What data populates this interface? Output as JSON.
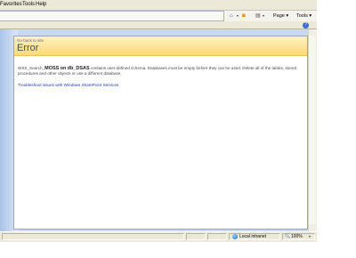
{
  "menubar": {
    "items": [
      "Favorites",
      "Tools",
      "Help"
    ]
  },
  "command_bar": {
    "home_icon": "home-icon",
    "feeds_icon": "feeds-icon",
    "print_icon": "print-icon",
    "page_label": "Page",
    "tools_label": "Tools",
    "dropdown_glyph": "▾"
  },
  "error_page": {
    "back_link": "Go back to site",
    "title": "Error",
    "message_prefix": "WSS_Search_",
    "message_server": "MOSS",
    "message_on": "on",
    "message_db": "db_DSAS",
    "message_rest": "contains user-defined schema.  Databases must be empty before they can be used.  Delete all of the tables, stored procedures and other objects or use a different database.",
    "troubleshoot_link": "Troubleshoot issues with Windows SharePoint Services."
  },
  "statusbar": {
    "zone": "Local intranet",
    "zoom": "100%"
  },
  "colors": {
    "header_gradient_top": "#fff3c4",
    "header_gradient_bottom": "#fcd97a",
    "link": "#1a3fa8",
    "viewport_bg": "#c8daf0"
  }
}
